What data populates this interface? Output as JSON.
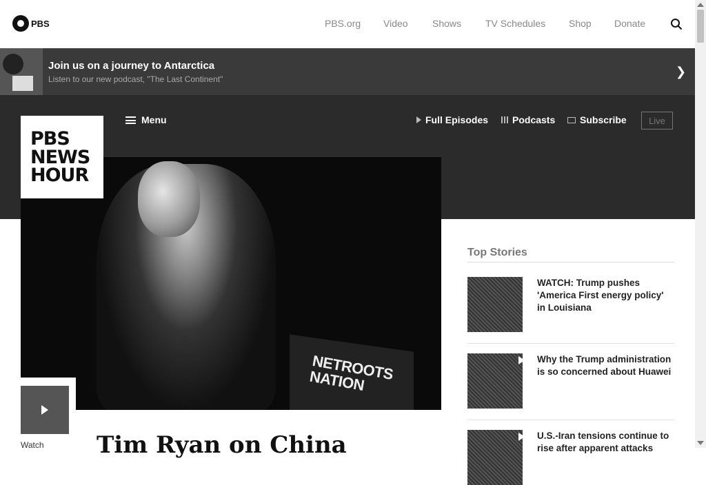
{
  "pbs": {
    "logo_text": "PBS",
    "nav": [
      "PBS.org",
      "Video",
      "Shows",
      "TV Schedules",
      "Shop",
      "Donate"
    ]
  },
  "promo": {
    "title": "Join us on a journey to Antarctica",
    "subtitle": "Listen to our new podcast, \"The Last Continent\""
  },
  "newshour": {
    "logo_lines": [
      "PBS",
      "NEWS",
      "HOUR"
    ],
    "menu_label": "Menu",
    "links": {
      "full_episodes": "Full Episodes",
      "podcasts": "Podcasts",
      "subscribe": "Subscribe",
      "live": "Live"
    }
  },
  "hero": {
    "podium_text": "NETROOTS NATION",
    "watch_label": "Watch",
    "headline": "Tim Ryan on China"
  },
  "top_stories": {
    "title": "Top Stories",
    "items": [
      "WATCH: Trump pushes 'America First energy policy' in Louisiana",
      "Why the Trump administration is so concerned about Huawei",
      "U.S.-Iran tensions continue to rise after apparent attacks"
    ]
  },
  "colors": {
    "promo_bg": "#3a3a3a",
    "header_bg": "#2b2b2b",
    "nav_text": "#888888"
  }
}
